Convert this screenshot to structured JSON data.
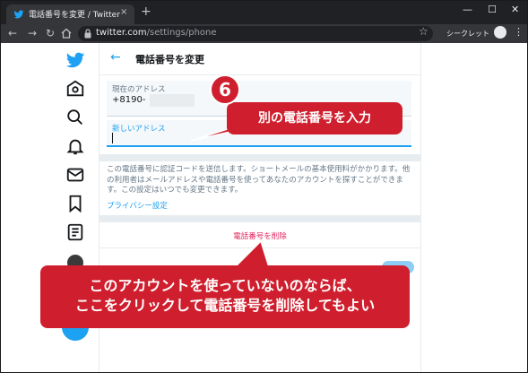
{
  "browser": {
    "tab_title": "電話番号を変更 / Twitter",
    "tab_close": "×",
    "new_tab": "+",
    "url_host": "twitter.com",
    "url_path": "/settings/phone",
    "incognito_label": "シークレット（2）",
    "window_controls": [
      "—",
      "☐",
      "✕"
    ]
  },
  "sidebar": {
    "icons": [
      "twitter-logo-icon",
      "home-icon",
      "explore-icon",
      "notifications-icon",
      "messages-icon",
      "bookmarks-icon",
      "lists-icon",
      "avatar",
      "tweet-button"
    ]
  },
  "page": {
    "back_arrow": "←",
    "title": "電話番号を変更",
    "current_label": "現在のアドレス",
    "current_value": "+8190-",
    "new_label": "新しいアドレス",
    "description": "この電話番号に認証コードを送信します。ショートメールの基本使用料がかかります。他の利用者はメールアドレスや電話番号を使ってあなたのアカウントを探すことができます。この設定はいつでも変更できます。",
    "privacy_link": "プライバシー設定",
    "delete_link": "電話番号を削除"
  },
  "annotations": {
    "step_number": "6",
    "top_callout": "別の電話番号を入力",
    "bottom_line1": "このアカウントを使っていないのならば、",
    "bottom_line2": "ここをクリックして電話番号を削除してもよい"
  },
  "colors": {
    "accent": "#1da1f2",
    "danger": "#e0245e",
    "callout": "#cf1f2e"
  }
}
